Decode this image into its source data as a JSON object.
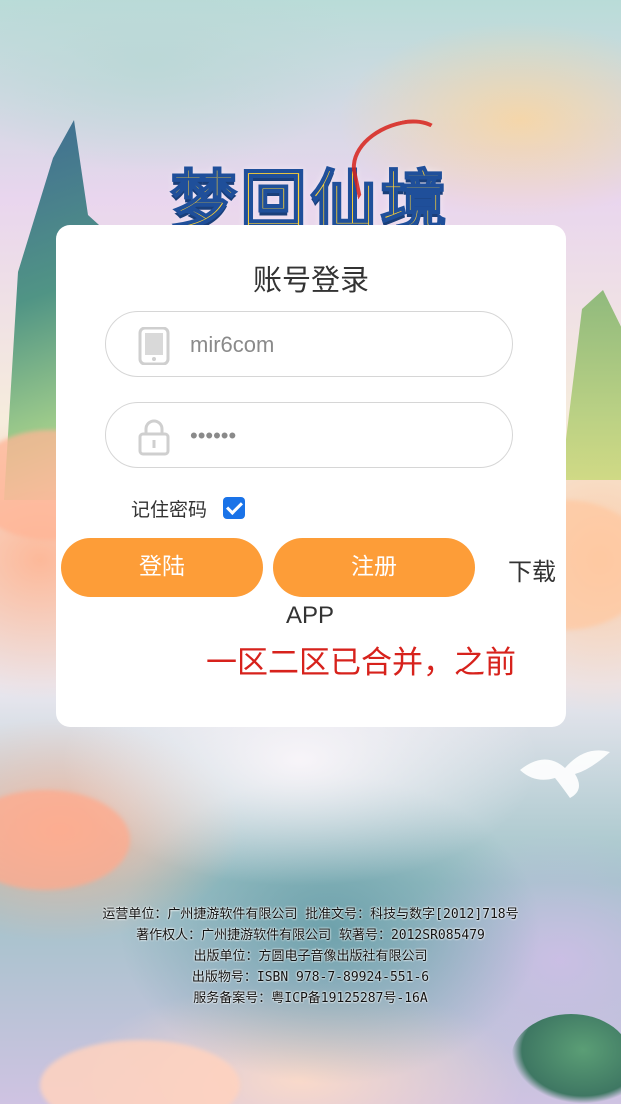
{
  "logo": {
    "text": "梦回仙境"
  },
  "login": {
    "title": "账号登录",
    "username_value": "mir6com",
    "password_value": "••••••",
    "remember_label": "记住密码",
    "remember_checked": true,
    "login_button": "登陆",
    "register_button": "注册",
    "download_label": "下载",
    "download_app": "APP",
    "notice": "一区二区已合并，之前"
  },
  "footer": {
    "lines": [
      "运营单位：广州捷游软件有限公司 批准文号：科技与数字[2012]718号",
      "著作权人：广州捷游软件有限公司 软著号：2012SR085479",
      "出版单位：方圆电子音像出版社有限公司",
      "出版物号：ISBN 978-7-89924-551-6",
      "服务备案号：粤ICP备19125287号-16A"
    ]
  },
  "colors": {
    "button": "#fd9d38",
    "notice": "#d7221c",
    "checkbox": "#1a73e8"
  },
  "icons": {
    "username": "phone-icon",
    "password": "lock-icon"
  }
}
